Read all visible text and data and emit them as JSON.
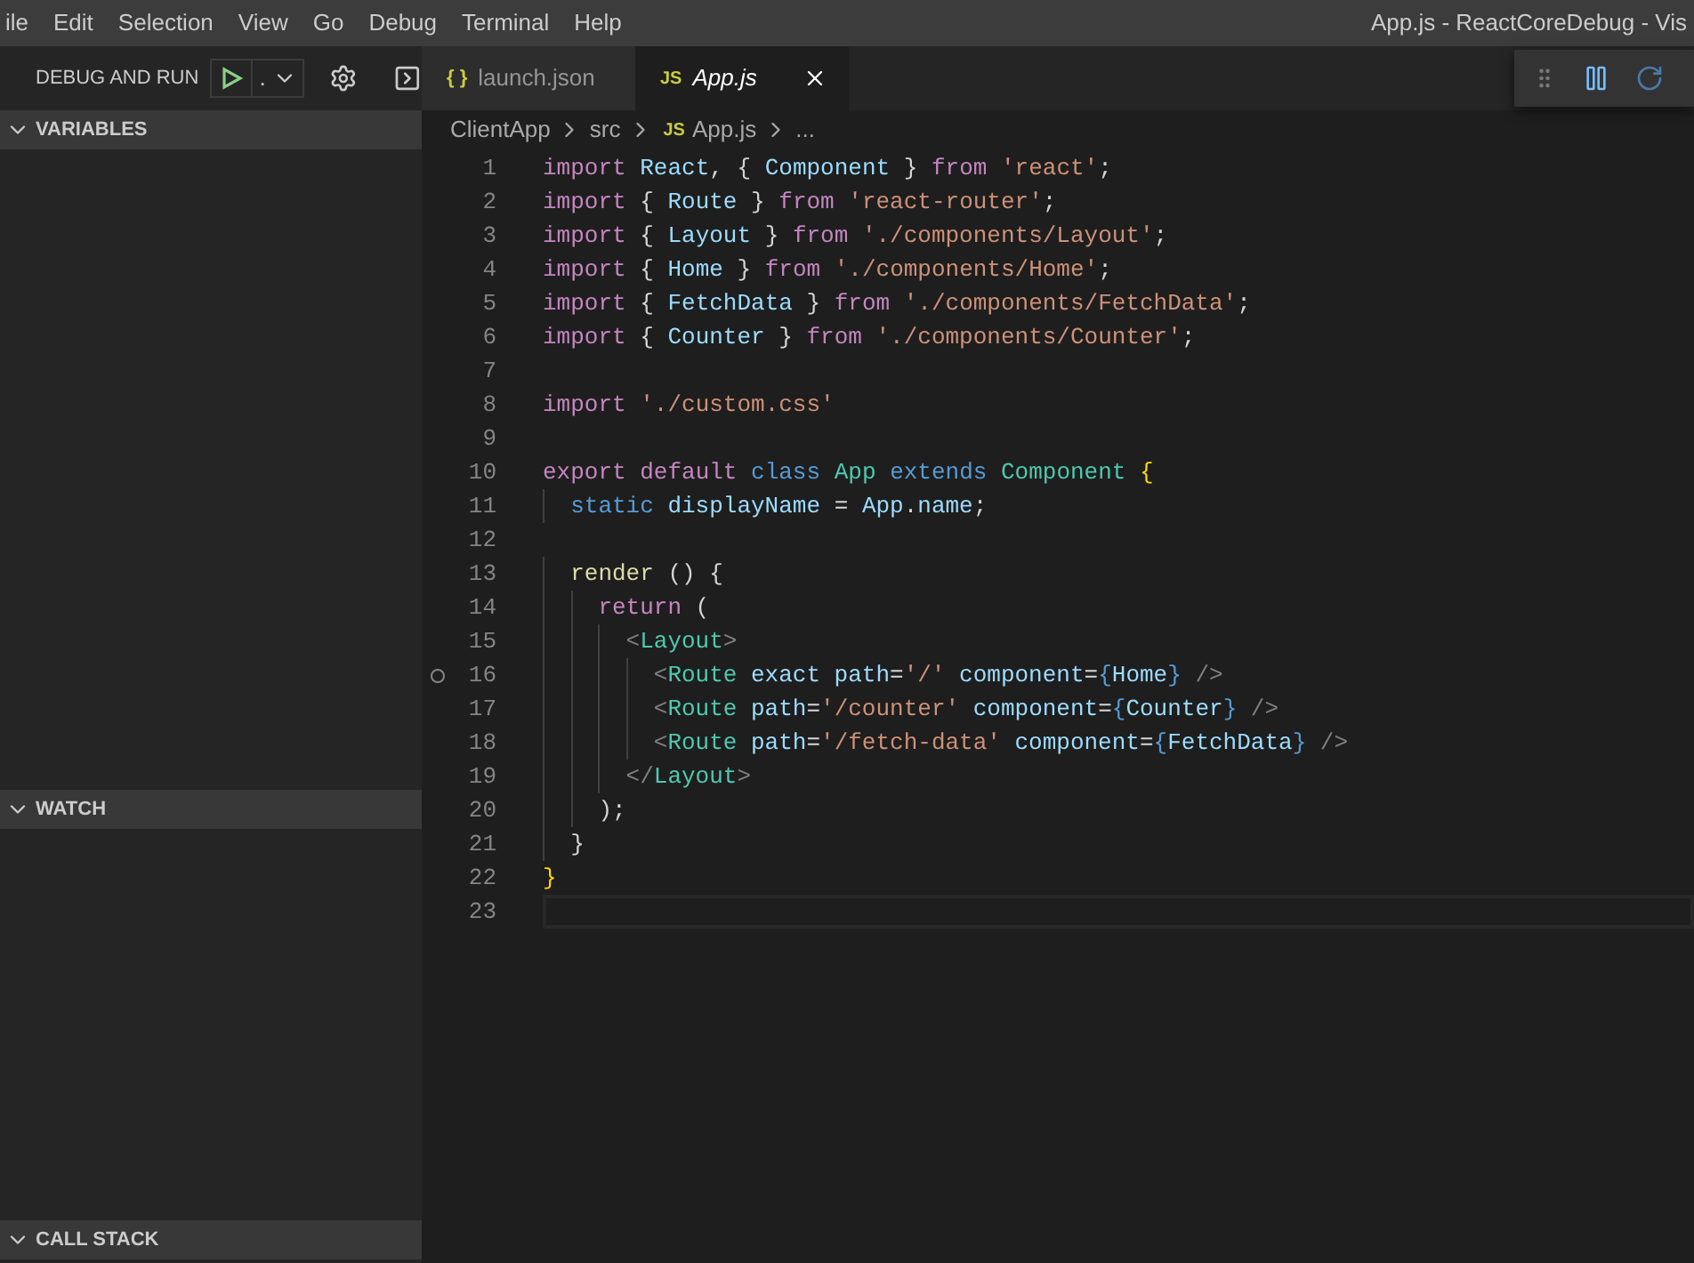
{
  "menu": [
    "ile",
    "Edit",
    "Selection",
    "View",
    "Go",
    "Debug",
    "Terminal",
    "Help"
  ],
  "window": {
    "title": "App.js - ReactCoreDebug - Vis"
  },
  "debug_bar": {
    "label": "DEBUG AND RUN",
    "config": "."
  },
  "sidebar": {
    "sections": [
      {
        "title": "VARIABLES",
        "expanded": true
      },
      {
        "title": "WATCH",
        "expanded": true
      },
      {
        "title": "CALL STACK",
        "expanded": true
      }
    ]
  },
  "tabs": [
    {
      "label": "launch.json",
      "icon": "{ }",
      "kind": "json",
      "selected": false
    },
    {
      "label": "App.js",
      "icon": "JS",
      "kind": "js",
      "selected": true
    }
  ],
  "breadcrumb": [
    {
      "label": "ClientApp"
    },
    {
      "label": "src"
    },
    {
      "label": "App.js",
      "icon": "JS"
    },
    {
      "label": "..."
    }
  ],
  "code": [
    {
      "number": "1",
      "tokens": [
        {
          "kind": "keyword",
          "text": "import "
        },
        {
          "kind": "var",
          "text": "React"
        },
        {
          "kind": "punct",
          "text": ", { "
        },
        {
          "kind": "var",
          "text": "Component"
        },
        {
          "kind": "punct",
          "text": " } "
        },
        {
          "kind": "keyword",
          "text": "from "
        },
        {
          "kind": "string",
          "text": "'react'"
        },
        {
          "kind": "punct",
          "text": ";"
        }
      ]
    },
    {
      "number": "2",
      "tokens": [
        {
          "kind": "keyword",
          "text": "import "
        },
        {
          "kind": "punct",
          "text": "{ "
        },
        {
          "kind": "var",
          "text": "Route"
        },
        {
          "kind": "punct",
          "text": " } "
        },
        {
          "kind": "keyword",
          "text": "from "
        },
        {
          "kind": "string",
          "text": "'react-router'"
        },
        {
          "kind": "punct",
          "text": ";"
        }
      ]
    },
    {
      "number": "3",
      "tokens": [
        {
          "kind": "keyword",
          "text": "import "
        },
        {
          "kind": "punct",
          "text": "{ "
        },
        {
          "kind": "var",
          "text": "Layout"
        },
        {
          "kind": "punct",
          "text": " } "
        },
        {
          "kind": "keyword",
          "text": "from "
        },
        {
          "kind": "string",
          "text": "'./components/Layout'"
        },
        {
          "kind": "punct",
          "text": ";"
        }
      ]
    },
    {
      "number": "4",
      "tokens": [
        {
          "kind": "keyword",
          "text": "import "
        },
        {
          "kind": "punct",
          "text": "{ "
        },
        {
          "kind": "var",
          "text": "Home"
        },
        {
          "kind": "punct",
          "text": " } "
        },
        {
          "kind": "keyword",
          "text": "from "
        },
        {
          "kind": "string",
          "text": "'./components/Home'"
        },
        {
          "kind": "punct",
          "text": ";"
        }
      ]
    },
    {
      "number": "5",
      "tokens": [
        {
          "kind": "keyword",
          "text": "import "
        },
        {
          "kind": "punct",
          "text": "{ "
        },
        {
          "kind": "var",
          "text": "FetchData"
        },
        {
          "kind": "punct",
          "text": " } "
        },
        {
          "kind": "keyword",
          "text": "from "
        },
        {
          "kind": "string",
          "text": "'./components/FetchData'"
        },
        {
          "kind": "punct",
          "text": ";"
        }
      ]
    },
    {
      "number": "6",
      "tokens": [
        {
          "kind": "keyword",
          "text": "import "
        },
        {
          "kind": "punct",
          "text": "{ "
        },
        {
          "kind": "var",
          "text": "Counter"
        },
        {
          "kind": "punct",
          "text": " } "
        },
        {
          "kind": "keyword",
          "text": "from "
        },
        {
          "kind": "string",
          "text": "'./components/Counter'"
        },
        {
          "kind": "punct",
          "text": ";"
        }
      ]
    },
    {
      "number": "7"
    },
    {
      "number": "8",
      "tokens": [
        {
          "kind": "keyword",
          "text": "import "
        },
        {
          "kind": "string",
          "text": "'./custom.css'"
        }
      ]
    },
    {
      "number": "9"
    },
    {
      "number": "10",
      "tokens": [
        {
          "kind": "keyword",
          "text": "export default "
        },
        {
          "kind": "storage",
          "text": "class "
        },
        {
          "kind": "type",
          "text": "App "
        },
        {
          "kind": "storage",
          "text": "extends "
        },
        {
          "kind": "type",
          "text": "Component "
        },
        {
          "kind": "bracket",
          "text": "{"
        }
      ]
    },
    {
      "number": "11",
      "tokens": [
        {
          "kind": "storage",
          "text": "  static "
        },
        {
          "kind": "var",
          "text": "displayName"
        },
        {
          "kind": "punct",
          "text": " = "
        },
        {
          "kind": "var",
          "text": "App"
        },
        {
          "kind": "punct",
          "text": "."
        },
        {
          "kind": "var",
          "text": "name"
        },
        {
          "kind": "punct",
          "text": ";"
        }
      ]
    },
    {
      "number": "12"
    },
    {
      "number": "13",
      "tokens": [
        {
          "kind": "func",
          "text": "  render"
        },
        {
          "kind": "punct",
          "text": " () {"
        }
      ]
    },
    {
      "number": "14",
      "tokens": [
        {
          "kind": "keyword",
          "text": "    return"
        },
        {
          "kind": "punct",
          "text": " ("
        }
      ]
    },
    {
      "number": "15",
      "tokens": [
        {
          "kind": "tag",
          "text": "      <"
        },
        {
          "kind": "type",
          "text": "Layout"
        },
        {
          "kind": "tag",
          "text": ">"
        }
      ]
    },
    {
      "number": "16",
      "breakpoint": true,
      "tokens": [
        {
          "kind": "tag",
          "text": "        <"
        },
        {
          "kind": "type",
          "text": "Route "
        },
        {
          "kind": "var",
          "text": "exact path"
        },
        {
          "kind": "punct",
          "text": "="
        },
        {
          "kind": "string",
          "text": "'/' "
        },
        {
          "kind": "var",
          "text": "component"
        },
        {
          "kind": "punct",
          "text": "="
        },
        {
          "kind": "storage",
          "text": "{"
        },
        {
          "kind": "var",
          "text": "Home"
        },
        {
          "kind": "storage",
          "text": "}"
        },
        {
          "kind": "tag",
          "text": " />"
        }
      ]
    },
    {
      "number": "17",
      "tokens": [
        {
          "kind": "tag",
          "text": "        <"
        },
        {
          "kind": "type",
          "text": "Route "
        },
        {
          "kind": "var",
          "text": "path"
        },
        {
          "kind": "punct",
          "text": "="
        },
        {
          "kind": "string",
          "text": "'/counter' "
        },
        {
          "kind": "var",
          "text": "component"
        },
        {
          "kind": "punct",
          "text": "="
        },
        {
          "kind": "storage",
          "text": "{"
        },
        {
          "kind": "var",
          "text": "Counter"
        },
        {
          "kind": "storage",
          "text": "}"
        },
        {
          "kind": "tag",
          "text": " />"
        }
      ]
    },
    {
      "number": "18",
      "tokens": [
        {
          "kind": "tag",
          "text": "        <"
        },
        {
          "kind": "type",
          "text": "Route "
        },
        {
          "kind": "var",
          "text": "path"
        },
        {
          "kind": "punct",
          "text": "="
        },
        {
          "kind": "string",
          "text": "'/fetch-data' "
        },
        {
          "kind": "var",
          "text": "component"
        },
        {
          "kind": "punct",
          "text": "="
        },
        {
          "kind": "storage",
          "text": "{"
        },
        {
          "kind": "var",
          "text": "FetchData"
        },
        {
          "kind": "storage",
          "text": "}"
        },
        {
          "kind": "tag",
          "text": " />"
        }
      ]
    },
    {
      "number": "19",
      "tokens": [
        {
          "kind": "tag",
          "text": "      </"
        },
        {
          "kind": "type",
          "text": "Layout"
        },
        {
          "kind": "tag",
          "text": ">"
        }
      ]
    },
    {
      "number": "20",
      "tokens": [
        {
          "kind": "punct",
          "text": "    );"
        }
      ]
    },
    {
      "number": "21",
      "tokens": [
        {
          "kind": "punct",
          "text": "  }"
        }
      ]
    },
    {
      "number": "22",
      "tokens": [
        {
          "kind": "bracket",
          "text": "}"
        }
      ]
    },
    {
      "number": "23",
      "current": true
    }
  ]
}
